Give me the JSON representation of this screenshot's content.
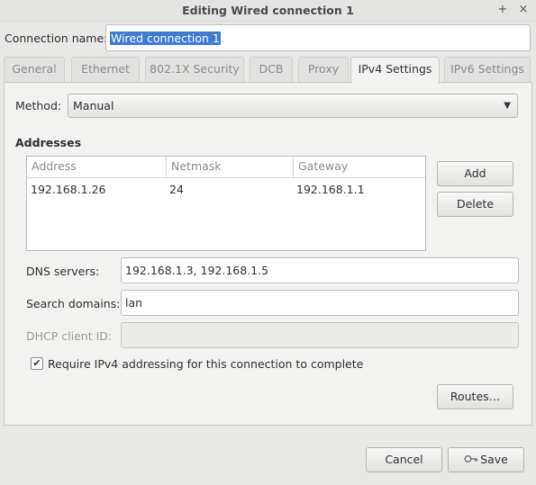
{
  "window": {
    "title": "Editing Wired connection 1"
  },
  "connection": {
    "label": "Connection name:",
    "value": "Wired connection 1"
  },
  "tabs": [
    {
      "label": "General"
    },
    {
      "label": "Ethernet"
    },
    {
      "label": "802.1X Security"
    },
    {
      "label": "DCB"
    },
    {
      "label": "Proxy"
    },
    {
      "label": "IPv4 Settings",
      "active": true
    },
    {
      "label": "IPv6 Settings"
    }
  ],
  "method": {
    "label": "Method:",
    "value": "Manual"
  },
  "addresses": {
    "title": "Addresses",
    "columns": [
      "Address",
      "Netmask",
      "Gateway"
    ],
    "rows": [
      {
        "address": "192.168.1.26",
        "netmask": "24",
        "gateway": "192.168.1.1"
      }
    ],
    "add_label": "Add",
    "delete_label": "Delete"
  },
  "dns": {
    "label": "DNS servers:",
    "value": "192.168.1.3, 192.168.1.5"
  },
  "search_domains": {
    "label": "Search domains:",
    "value": "lan"
  },
  "dhcp_client_id": {
    "label": "DHCP client ID:",
    "value": ""
  },
  "require_ipv4": {
    "label": "Require IPv4 addressing for this connection to complete",
    "checked": true
  },
  "routes_label": "Routes…",
  "footer": {
    "cancel_label": "Cancel",
    "save_label": "Save"
  }
}
